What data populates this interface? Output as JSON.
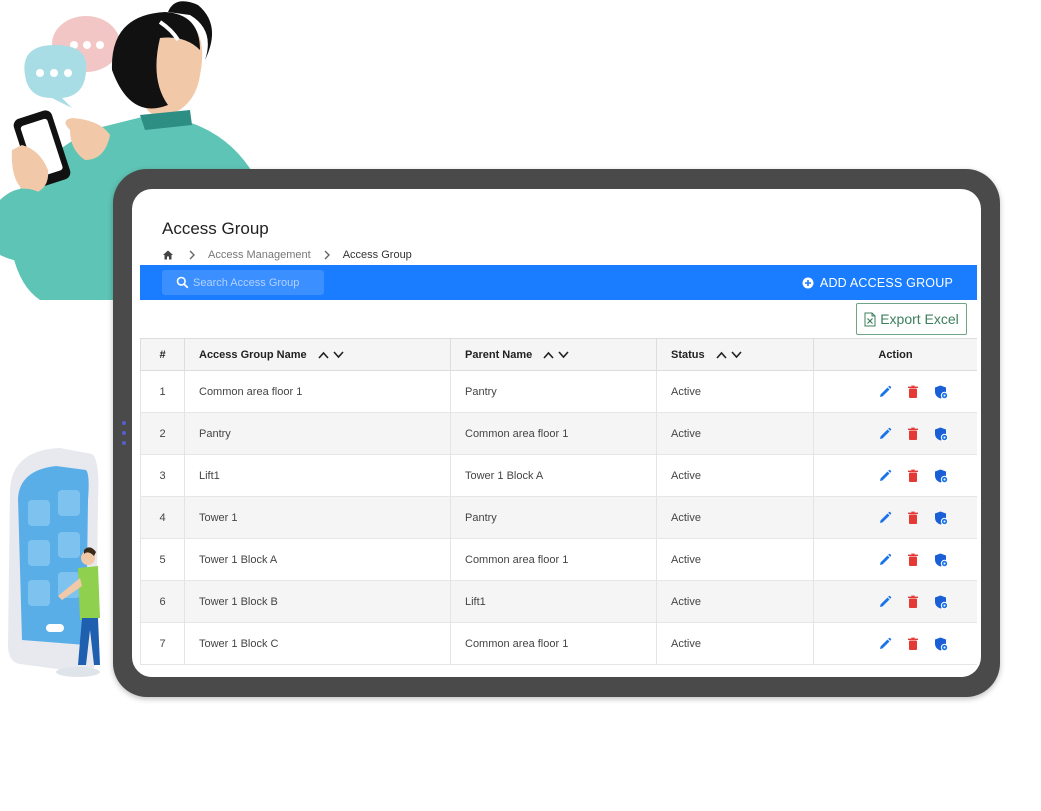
{
  "page": {
    "title": "Access Group",
    "breadcrumb": [
      "Access Management",
      "Access Group"
    ]
  },
  "toolbar": {
    "search_placeholder": "Search Access Group",
    "add_label": "ADD ACCESS GROUP",
    "export_label": "Export Excel"
  },
  "table": {
    "headers": {
      "num": "#",
      "name": "Access Group Name",
      "parent": "Parent Name",
      "status": "Status",
      "action": "Action"
    },
    "rows": [
      {
        "num": "1",
        "name": "Common area floor 1",
        "parent": "Pantry",
        "status": "Active"
      },
      {
        "num": "2",
        "name": "Pantry",
        "parent": "Common area floor 1",
        "status": "Active"
      },
      {
        "num": "3",
        "name": "Lift1",
        "parent": "Tower 1 Block A",
        "status": "Active"
      },
      {
        "num": "4",
        "name": "Tower 1",
        "parent": "Pantry",
        "status": "Active"
      },
      {
        "num": "5",
        "name": "Tower 1 Block A",
        "parent": "Common area floor 1",
        "status": "Active"
      },
      {
        "num": "6",
        "name": "Tower 1 Block B",
        "parent": "Lift1",
        "status": "Active"
      },
      {
        "num": "7",
        "name": "Tower 1 Block C",
        "parent": "Common area floor 1",
        "status": "Active"
      }
    ]
  },
  "icons": {
    "home": "home-icon",
    "search": "search-icon",
    "add": "plus-circle-icon",
    "excel": "excel-file-icon",
    "edit": "pencil-icon",
    "delete": "trash-icon",
    "permission": "shield-icon"
  },
  "colors": {
    "primary": "#1a7cff",
    "edit": "#1a73e8",
    "delete": "#e53935",
    "export": "#3c7f5b"
  }
}
